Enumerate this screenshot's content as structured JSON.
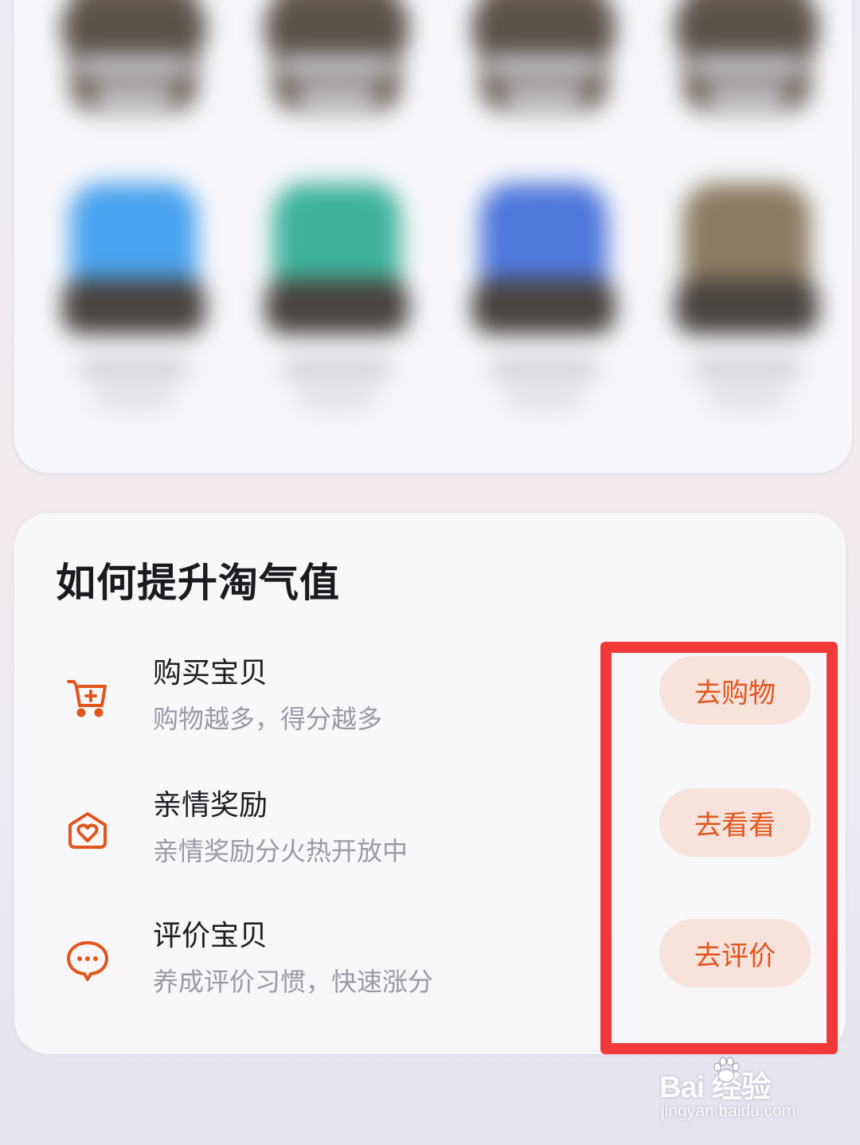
{
  "section": {
    "title": "如何提升淘气值"
  },
  "tasks": [
    {
      "name": "购买宝贝",
      "desc": "购物越多，得分越多",
      "button": "去购物",
      "icon": "cart-plus-icon"
    },
    {
      "name": "亲情奖励",
      "desc": "亲情奖励分火热开放中",
      "button": "去看看",
      "icon": "heart-house-icon"
    },
    {
      "name": "评价宝贝",
      "desc": "养成评价习惯，快速涨分",
      "button": "去评价",
      "icon": "chat-bubble-icon"
    }
  ],
  "colors": {
    "accent": "#e2561c",
    "button_bg": "#f7e2dc",
    "highlight": "#f03a3a"
  },
  "watermark": {
    "logo": "Bai   经验",
    "url": "jingyan.baidu.com"
  }
}
